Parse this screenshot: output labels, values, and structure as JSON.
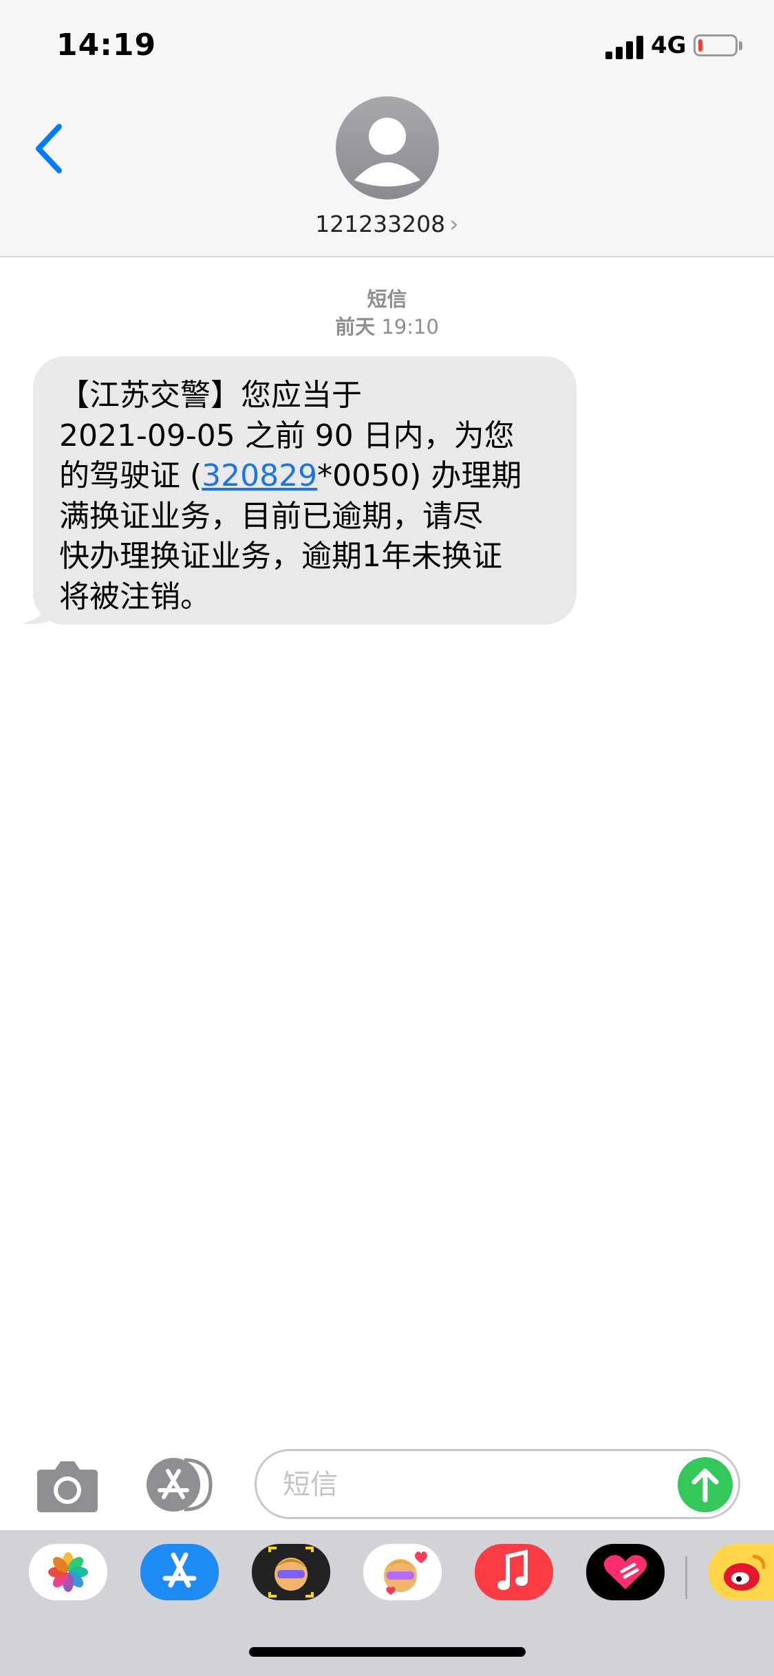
{
  "status_bar": {
    "time": "14:19",
    "network": "4G",
    "battery_level": 0.1
  },
  "header": {
    "contact_number": "121233208",
    "contact_chevron": "›"
  },
  "conversation": {
    "service_label": "短信",
    "timestamp_day": "前天",
    "timestamp_time": "19:10",
    "message": {
      "line1": "【江苏交警】您应当于",
      "line2": "2021-09-05 之前 90 日内，为您",
      "line3_pre": "的驾驶证 (",
      "line3_link": "320829",
      "line3_post": "*0050) 办理期",
      "line4": "满换证业务，目前已逾期，请尽",
      "line5": "快办理换证业务，逾期1年未换证",
      "line6": "将被注销。"
    }
  },
  "input_bar": {
    "placeholder": "短信"
  },
  "app_drawer": {
    "apps": [
      "photos-icon",
      "app-store-icon",
      "memoji-icon",
      "memoji-stickers-icon",
      "music-icon",
      "digital-touch-icon",
      "weibo-icon"
    ]
  },
  "colors": {
    "accent": "#007aff",
    "send": "#34c759",
    "bubble": "#e9e9eb",
    "link": "#1a73e8"
  }
}
